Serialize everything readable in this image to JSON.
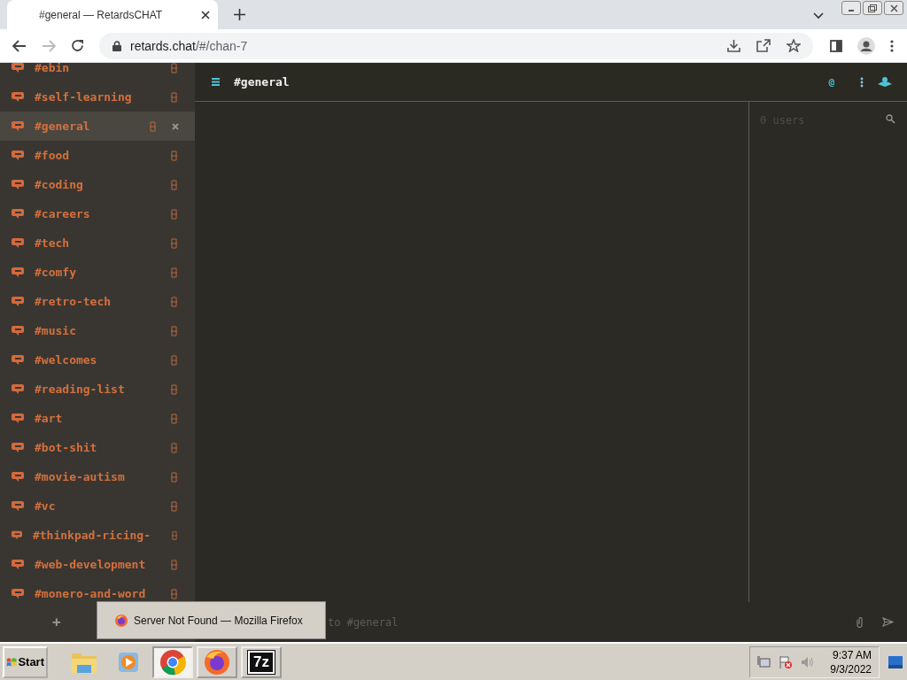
{
  "browser": {
    "tab_title": "#general — RetardsCHAT",
    "url_host": "retards.chat",
    "url_path": "/#/chan-7",
    "forward_disabled": true
  },
  "sidebar": {
    "channels": [
      {
        "name": "#ebin",
        "selected": false
      },
      {
        "name": "#self-learning",
        "selected": false
      },
      {
        "name": "#general",
        "selected": true
      },
      {
        "name": "#food",
        "selected": false
      },
      {
        "name": "#coding",
        "selected": false
      },
      {
        "name": "#careers",
        "selected": false
      },
      {
        "name": "#tech",
        "selected": false
      },
      {
        "name": "#comfy",
        "selected": false
      },
      {
        "name": "#retro-tech",
        "selected": false
      },
      {
        "name": "#music",
        "selected": false
      },
      {
        "name": "#welcomes",
        "selected": false
      },
      {
        "name": "#reading-list",
        "selected": false
      },
      {
        "name": "#art",
        "selected": false
      },
      {
        "name": "#bot-shit",
        "selected": false
      },
      {
        "name": "#movie-autism",
        "selected": false
      },
      {
        "name": "#vc",
        "selected": false
      },
      {
        "name": "#thinkpad-ricing-",
        "selected": false
      },
      {
        "name": "#web-development",
        "selected": false
      },
      {
        "name": "#monero-and-word",
        "selected": false
      }
    ],
    "add_label": "+"
  },
  "header": {
    "channel": "#general",
    "mention_label": "@"
  },
  "users_panel": {
    "count": "0 users"
  },
  "composer": {
    "placeholder": "to #general"
  },
  "tooltip": "Server Not Found — Mozilla Firefox",
  "taskbar": {
    "start": "Start",
    "apps": [
      {
        "kind": "folder",
        "active": false
      },
      {
        "kind": "media",
        "active": false
      },
      {
        "kind": "chrome",
        "active": true
      },
      {
        "kind": "firefox",
        "active": false
      },
      {
        "kind": "sevenzip",
        "active": false,
        "label": "7z"
      }
    ],
    "time": "9:37 AM",
    "date": "9/3/2022"
  }
}
